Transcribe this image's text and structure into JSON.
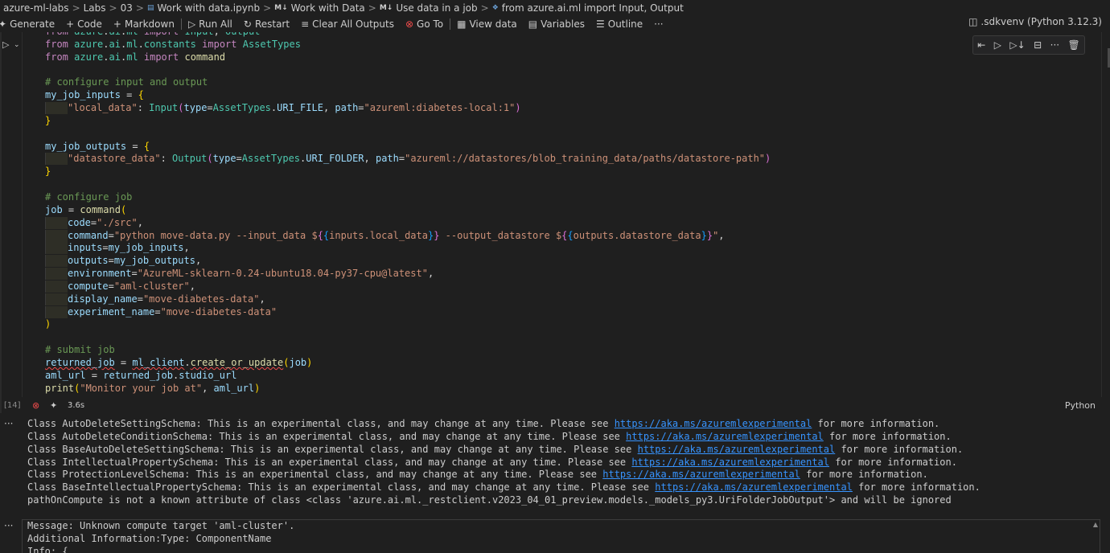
{
  "breadcrumb": {
    "items": [
      "azure-ml-labs",
      "Labs",
      "03",
      "Work with data.ipynb",
      "Work with Data",
      "Use data in a job",
      "from azure.ai.ml import Input, Output"
    ],
    "separator": ">"
  },
  "toolbar": {
    "generate": "Generate",
    "code": "Code",
    "markdown": "Markdown",
    "run_all": "Run All",
    "restart": "Restart",
    "clear_outputs": "Clear All Outputs",
    "go_to": "Go To",
    "view_data": "View data",
    "variables": "Variables",
    "outline": "Outline",
    "more": "···",
    "kernel": ".sdkvenv (Python 3.12.3)"
  },
  "cell": {
    "execution_count": "[14]",
    "duration": "3.6s",
    "language": "Python",
    "code_lines": [
      "from azure.ai.ml import Input, Output",
      "from azure.ai.ml.constants import AssetTypes",
      "from azure.ai.ml import command",
      "",
      "# configure input and output",
      "my_job_inputs = {",
      "    \"local_data\": Input(type=AssetTypes.URI_FILE, path=\"azureml:diabetes-local:1\")",
      "}",
      "",
      "my_job_outputs = {",
      "    \"datastore_data\": Output(type=AssetTypes.URI_FOLDER, path=\"azureml://datastores/blob_training_data/paths/datastore-path\")",
      "}",
      "",
      "# configure job",
      "job = command(",
      "    code=\"./src\",",
      "    command=\"python move-data.py --input_data ${{inputs.local_data}} --output_datastore ${{outputs.datastore_data}}\",",
      "    inputs=my_job_inputs,",
      "    outputs=my_job_outputs,",
      "    environment=\"AzureML-sklearn-0.24-ubuntu18.04-py37-cpu@latest\",",
      "    compute=\"aml-cluster\",",
      "    display_name=\"move-diabetes-data\",",
      "    experiment_name=\"move-diabetes-data\"",
      ")",
      "",
      "# submit job",
      "returned_job = ml_client.create_or_update(job)",
      "aml_url = returned_job.studio_url",
      "print(\"Monitor your job at\", aml_url)"
    ]
  },
  "output1": {
    "menu": "···",
    "link": "https://aka.ms/azuremlexperimental",
    "lines": [
      {
        "prefix": "Class AutoDeleteSettingSchema: This is an experimental class, and may change at any time. Please see ",
        "link": "https://aka.ms/azuremlexperimental",
        "suffix": " for more information."
      },
      {
        "prefix": "Class AutoDeleteConditionSchema: This is an experimental class, and may change at any time. Please see ",
        "link": "https://aka.ms/azuremlexperimental",
        "suffix": " for more information."
      },
      {
        "prefix": "Class BaseAutoDeleteSettingSchema: This is an experimental class, and may change at any time. Please see ",
        "link": "https://aka.ms/azuremlexperimental",
        "suffix": " for more information."
      },
      {
        "prefix": "Class IntellectualPropertySchema: This is an experimental class, and may change at any time. Please see ",
        "link": "https://aka.ms/azuremlexperimental",
        "suffix": " for more information."
      },
      {
        "prefix": "Class ProtectionLevelSchema: This is an experimental class, and may change at any time. Please see ",
        "link": "https://aka.ms/azuremlexperimental",
        "suffix": " for more information."
      },
      {
        "prefix": "Class BaseIntellectualPropertySchema: This is an experimental class, and may change at any time. Please see ",
        "link": "https://aka.ms/azuremlexperimental",
        "suffix": " for more information."
      },
      {
        "prefix": "pathOnCompute is not a known attribute of class <class 'azure.ai.ml._restclient.v2023_04_01_preview.models._models_py3.UriFolderJobOutput'> and will be ignored",
        "link": "",
        "suffix": ""
      }
    ]
  },
  "output2": {
    "menu": "···",
    "lines": [
      "Message: Unknown compute target 'aml-cluster'.",
      "Additional Information:Type: ComponentName",
      "Info: {"
    ]
  },
  "icons": {
    "generate": "sparkle-icon",
    "code": "plus-icon",
    "markdown": "plus-icon",
    "run_all": "run-all-icon",
    "restart": "restart-icon",
    "clear_outputs": "clear-icon",
    "go_to": "goto-icon",
    "view_data": "table-icon",
    "variables": "variables-icon",
    "outline": "outline-icon",
    "kernel": "kernel-icon"
  },
  "colors": {
    "background": "#1f1f1f",
    "link": "#3794ff",
    "error": "#f14c4c",
    "keyword": "#c586c0",
    "string": "#ce9178",
    "comment": "#6a9955",
    "class": "#4ec9b0",
    "variable": "#9cdcfe",
    "function": "#dcdcaa"
  }
}
